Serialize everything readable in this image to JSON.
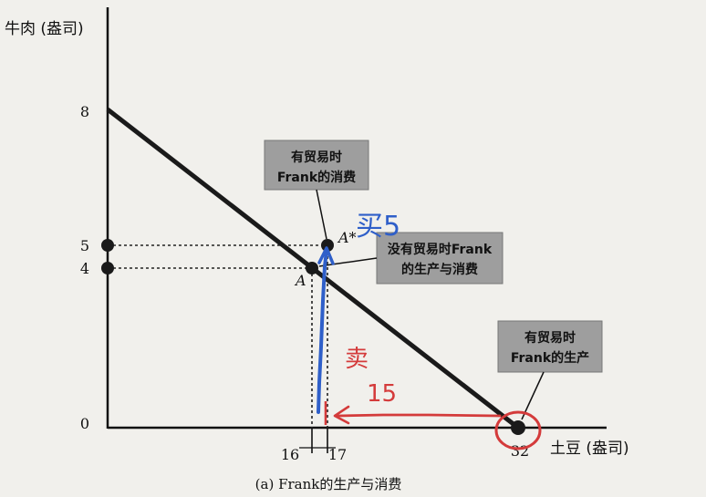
{
  "chart_data": {
    "type": "line",
    "ylabel": "牛肉 (盎司)",
    "xlabel": "土豆 (盎司)",
    "caption": "(a) Frank的生产与消费",
    "series": [
      {
        "x": [
          0,
          32
        ],
        "y": [
          8,
          0
        ]
      }
    ],
    "xticks": [
      {
        "value": 16,
        "label": "16"
      },
      {
        "value": 17,
        "label": "17"
      },
      {
        "value": 32,
        "label": "32"
      }
    ],
    "yticks": [
      {
        "value": 0,
        "label": "0"
      },
      {
        "value": 4,
        "label": "4"
      },
      {
        "value": 5,
        "label": "5"
      },
      {
        "value": 8,
        "label": "8"
      }
    ],
    "points": [
      {
        "id": "A",
        "label": "A",
        "x": 16,
        "y": 4
      },
      {
        "id": "Astar",
        "label": "A*",
        "x": 17,
        "y": 5
      },
      {
        "id": "P32",
        "label": "",
        "x": 32,
        "y": 0
      }
    ],
    "callouts": [
      {
        "id": "trade-consumption",
        "lines": [
          "有贸易时",
          "Frank的消费"
        ]
      },
      {
        "id": "no-trade",
        "lines": [
          "没有贸易时Frank",
          "的生产与消费"
        ]
      },
      {
        "id": "trade-production",
        "lines": [
          "有贸易时",
          "Frank的生产"
        ]
      }
    ],
    "annotations": {
      "blue": "买5",
      "red_top": "卖",
      "red_bottom": "15"
    },
    "colors": {
      "line": "#1a1a1a",
      "callout_fill": "#9e9e9e",
      "blue_ink": "#2f5fc9",
      "red_ink": "#d43b3b"
    }
  }
}
